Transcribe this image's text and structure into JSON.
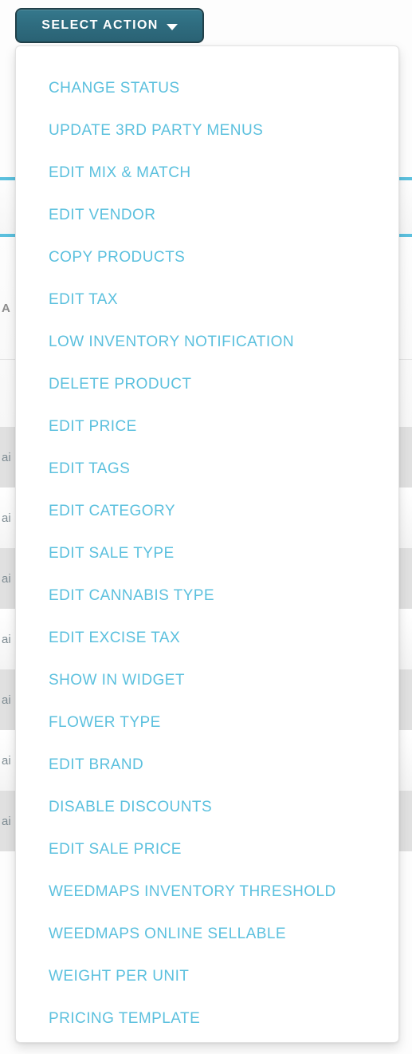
{
  "colors": {
    "accent_cyan": "#5bc0de",
    "button_teal": "#2f6d80",
    "button_border": "#214049",
    "panel_background": "#ffffff",
    "row_stripe": "#e0e0e0",
    "muted_text": "#7e8c93"
  },
  "toolbar": {
    "select_action_label": "SELECT ACTION",
    "caret_icon": "chevron-down-icon"
  },
  "action_menu": {
    "items": [
      {
        "label": "CHANGE STATUS"
      },
      {
        "label": "UPDATE 3RD PARTY MENUS"
      },
      {
        "label": "EDIT MIX & MATCH"
      },
      {
        "label": "EDIT VENDOR"
      },
      {
        "label": "COPY PRODUCTS"
      },
      {
        "label": "EDIT TAX"
      },
      {
        "label": "LOW INVENTORY NOTIFICATION"
      },
      {
        "label": "DELETE PRODUCT"
      },
      {
        "label": "EDIT PRICE"
      },
      {
        "label": "EDIT TAGS"
      },
      {
        "label": "EDIT CATEGORY"
      },
      {
        "label": "EDIT SALE TYPE"
      },
      {
        "label": "EDIT CANNABIS TYPE"
      },
      {
        "label": "EDIT EXCISE TAX"
      },
      {
        "label": "SHOW IN WIDGET"
      },
      {
        "label": "FLOWER TYPE"
      },
      {
        "label": "EDIT BRAND"
      },
      {
        "label": "DISABLE DISCOUNTS"
      },
      {
        "label": "EDIT SALE PRICE"
      },
      {
        "label": "WEEDMAPS INVENTORY THRESHOLD"
      },
      {
        "label": "WEEDMAPS ONLINE SELLABLE"
      },
      {
        "label": "WEIGHT PER UNIT"
      },
      {
        "label": "PRICING TEMPLATE"
      }
    ]
  },
  "background_table": {
    "header_visible_text": "A",
    "rows": [
      {
        "visible_text": "ai"
      },
      {
        "visible_text": "ai"
      },
      {
        "visible_text": "ai"
      },
      {
        "visible_text": "ai"
      },
      {
        "visible_text": "ai"
      },
      {
        "visible_text": "ai"
      },
      {
        "visible_text": "ai"
      }
    ]
  }
}
